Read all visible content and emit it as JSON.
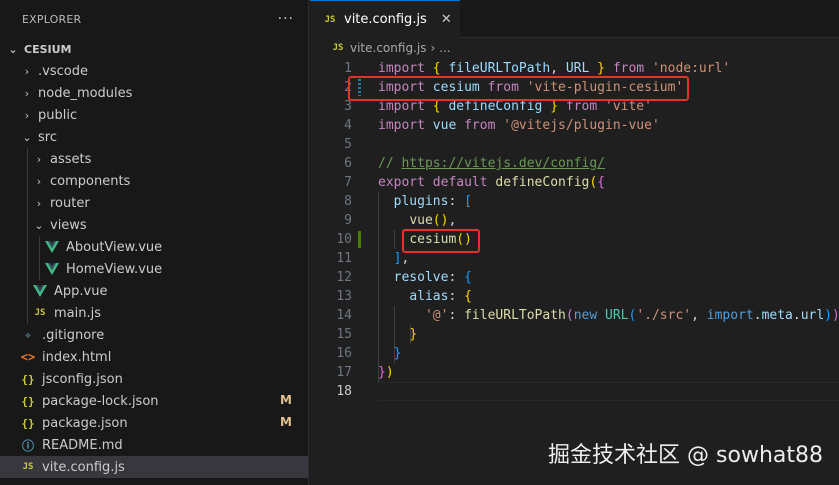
{
  "explorer": {
    "title": "EXPLORER",
    "more": "···",
    "project": "CESIUM",
    "items": [
      {
        "label": ".vscode",
        "chevron": "›",
        "depth": 0,
        "type": "folder"
      },
      {
        "label": "node_modules",
        "chevron": "›",
        "depth": 0,
        "type": "folder"
      },
      {
        "label": "public",
        "chevron": "›",
        "depth": 0,
        "type": "folder"
      },
      {
        "label": "src",
        "chevron": "⌄",
        "depth": 0,
        "type": "folder"
      },
      {
        "label": "assets",
        "chevron": "›",
        "depth": 1,
        "type": "folder"
      },
      {
        "label": "components",
        "chevron": "›",
        "depth": 1,
        "type": "folder"
      },
      {
        "label": "router",
        "chevron": "›",
        "depth": 1,
        "type": "folder"
      },
      {
        "label": "views",
        "chevron": "⌄",
        "depth": 1,
        "type": "folder"
      },
      {
        "label": "AboutView.vue",
        "depth": 2,
        "type": "vue"
      },
      {
        "label": "HomeView.vue",
        "depth": 2,
        "type": "vue"
      },
      {
        "label": "App.vue",
        "depth": 1,
        "type": "vue"
      },
      {
        "label": "main.js",
        "depth": 1,
        "type": "js",
        "icon": "JS"
      },
      {
        "label": ".gitignore",
        "depth": 0,
        "type": "git",
        "icon": "◆"
      },
      {
        "label": "index.html",
        "depth": 0,
        "type": "html",
        "icon": "<>"
      },
      {
        "label": "jsconfig.json",
        "depth": 0,
        "type": "json",
        "icon": "{}"
      },
      {
        "label": "package-lock.json",
        "depth": 0,
        "type": "json",
        "icon": "{}",
        "badge": "M"
      },
      {
        "label": "package.json",
        "depth": 0,
        "type": "json",
        "icon": "{}",
        "badge": "M"
      },
      {
        "label": "README.md",
        "depth": 0,
        "type": "md",
        "icon": "ⓘ"
      },
      {
        "label": "vite.config.js",
        "depth": 0,
        "type": "js",
        "icon": "JS",
        "selected": true
      }
    ]
  },
  "editor": {
    "tab": {
      "icon": "JS",
      "label": "vite.config.js",
      "close": "✕"
    },
    "breadcrumb": {
      "icon": "JS",
      "file": "vite.config.js",
      "sep": "›",
      "rest": "..."
    },
    "lines": [
      {
        "n": "1",
        "tokens": [
          [
            "kw",
            "import"
          ],
          [
            "pn",
            " "
          ],
          [
            "p1",
            "{"
          ],
          [
            "pn",
            " "
          ],
          [
            "id",
            "fileURLToPath"
          ],
          [
            "pn",
            ", "
          ],
          [
            "id",
            "URL"
          ],
          [
            "pn",
            " "
          ],
          [
            "p1",
            "}"
          ],
          [
            "pn",
            " "
          ],
          [
            "kw",
            "from"
          ],
          [
            "pn",
            " "
          ],
          [
            "str",
            "'node:url'"
          ]
        ]
      },
      {
        "n": "2",
        "gutter": "mod",
        "tokens": [
          [
            "kw",
            "import"
          ],
          [
            "pn",
            " "
          ],
          [
            "id",
            "cesium"
          ],
          [
            "pn",
            " "
          ],
          [
            "kw",
            "from"
          ],
          [
            "pn",
            " "
          ],
          [
            "str",
            "'vite-plugin-cesium'"
          ]
        ]
      },
      {
        "n": "3",
        "tokens": [
          [
            "kw",
            "import"
          ],
          [
            "pn",
            " "
          ],
          [
            "p1",
            "{"
          ],
          [
            "pn",
            " "
          ],
          [
            "id",
            "defineConfig"
          ],
          [
            "pn",
            " "
          ],
          [
            "p1",
            "}"
          ],
          [
            "pn",
            " "
          ],
          [
            "kw",
            "from"
          ],
          [
            "pn",
            " "
          ],
          [
            "str",
            "'vite'"
          ]
        ]
      },
      {
        "n": "4",
        "tokens": [
          [
            "kw",
            "import"
          ],
          [
            "pn",
            " "
          ],
          [
            "id",
            "vue"
          ],
          [
            "pn",
            " "
          ],
          [
            "kw",
            "from"
          ],
          [
            "pn",
            " "
          ],
          [
            "str",
            "'@vitejs/plugin-vue'"
          ]
        ]
      },
      {
        "n": "5",
        "tokens": []
      },
      {
        "n": "6",
        "tokens": [
          [
            "cm",
            "// "
          ],
          [
            "url",
            "https://vitejs.dev/config/"
          ]
        ]
      },
      {
        "n": "7",
        "tokens": [
          [
            "kw",
            "export"
          ],
          [
            "pn",
            " "
          ],
          [
            "kw",
            "default"
          ],
          [
            "pn",
            " "
          ],
          [
            "fn",
            "defineConfig"
          ],
          [
            "p1",
            "("
          ],
          [
            "p2",
            "{"
          ]
        ]
      },
      {
        "n": "8",
        "tokens": [
          [
            "pn",
            "  "
          ],
          [
            "id",
            "plugins"
          ],
          [
            "pn",
            ": "
          ],
          [
            "p3",
            "["
          ]
        ]
      },
      {
        "n": "9",
        "tokens": [
          [
            "pn",
            "    "
          ],
          [
            "fn",
            "vue"
          ],
          [
            "p1",
            "("
          ],
          [
            "p1",
            ")"
          ],
          [
            "pn",
            ","
          ]
        ]
      },
      {
        "n": "10",
        "gutter": "add",
        "tokens": [
          [
            "pn",
            "    "
          ],
          [
            "fn",
            "cesium"
          ],
          [
            "p1",
            "("
          ],
          [
            "p1",
            ")"
          ]
        ]
      },
      {
        "n": "11",
        "tokens": [
          [
            "pn",
            "  "
          ],
          [
            "p3",
            "]"
          ],
          [
            "pn",
            ","
          ]
        ]
      },
      {
        "n": "12",
        "tokens": [
          [
            "pn",
            "  "
          ],
          [
            "id",
            "resolve"
          ],
          [
            "pn",
            ": "
          ],
          [
            "p3",
            "{"
          ]
        ]
      },
      {
        "n": "13",
        "tokens": [
          [
            "pn",
            "    "
          ],
          [
            "id",
            "alias"
          ],
          [
            "pn",
            ": "
          ],
          [
            "p1",
            "{"
          ]
        ]
      },
      {
        "n": "14",
        "tokens": [
          [
            "pn",
            "      "
          ],
          [
            "str",
            "'@'"
          ],
          [
            "pn",
            ": "
          ],
          [
            "fn",
            "fileURLToPath"
          ],
          [
            "p2",
            "("
          ],
          [
            "kw2",
            "new"
          ],
          [
            "pn",
            " "
          ],
          [
            "cls",
            "URL"
          ],
          [
            "p3",
            "("
          ],
          [
            "str",
            "'./src'"
          ],
          [
            "pn",
            ", "
          ],
          [
            "kw2",
            "import"
          ],
          [
            "pn",
            "."
          ],
          [
            "id",
            "meta"
          ],
          [
            "pn",
            "."
          ],
          [
            "id",
            "url"
          ],
          [
            "p3",
            ")"
          ],
          [
            "p2",
            ")"
          ]
        ]
      },
      {
        "n": "15",
        "tokens": [
          [
            "pn",
            "    "
          ],
          [
            "p1",
            "}"
          ]
        ]
      },
      {
        "n": "16",
        "tokens": [
          [
            "pn",
            "  "
          ],
          [
            "p3",
            "}"
          ]
        ]
      },
      {
        "n": "17",
        "tokens": [
          [
            "p2",
            "}"
          ],
          [
            "p1",
            ")"
          ]
        ]
      },
      {
        "n": "18",
        "current": true,
        "tokens": []
      }
    ]
  },
  "watermark": "掘金技术社区 @ sowhat88",
  "colors": {
    "highlight": "#e8312a",
    "accent": "#0078d4",
    "vue_green": "#41b883",
    "modified": "#e2c08d"
  }
}
